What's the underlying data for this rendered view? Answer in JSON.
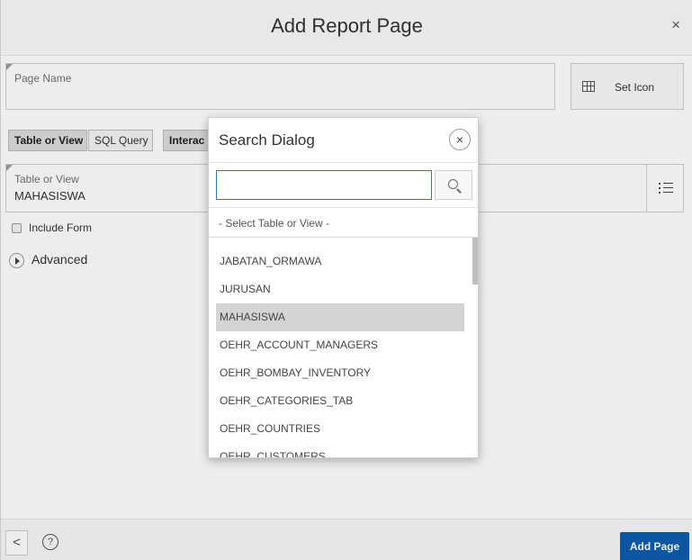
{
  "dialog": {
    "title": "Add Report Page",
    "close_label": "×"
  },
  "page_name": {
    "label": "Page Name",
    "value": ""
  },
  "set_icon": {
    "label": "Set Icon"
  },
  "source_tabs": [
    {
      "label": "Table or View",
      "active": true
    },
    {
      "label": "SQL Query",
      "active": false
    },
    {
      "label": "Interac",
      "active": false
    }
  ],
  "table_or_view": {
    "label": "Table or View",
    "value": "MAHASISWA"
  },
  "include_form": {
    "label": "Include Form",
    "checked": false
  },
  "advanced": {
    "label": "Advanced"
  },
  "footer": {
    "back_label": "<",
    "help_label": "?",
    "add_page_label": "Add Page"
  },
  "search_dialog": {
    "title": "Search Dialog",
    "close_label": "×",
    "search_value": "",
    "select_placeholder": "- Select Table or View -",
    "items": [
      {
        "label": "JABATAN_ORMAWA",
        "selected": false
      },
      {
        "label": "JURUSAN",
        "selected": false
      },
      {
        "label": "MAHASISWA",
        "selected": true
      },
      {
        "label": "OEHR_ACCOUNT_MANAGERS",
        "selected": false
      },
      {
        "label": "OEHR_BOMBAY_INVENTORY",
        "selected": false
      },
      {
        "label": "OEHR_CATEGORIES_TAB",
        "selected": false
      },
      {
        "label": "OEHR_COUNTRIES",
        "selected": false
      },
      {
        "label": "OEHR_CUSTOMERS",
        "selected": false
      }
    ]
  },
  "colors": {
    "primary_button": "#0d5cae",
    "input_focus": "#2a7ab9",
    "selected_row": "#d4d4d4"
  }
}
